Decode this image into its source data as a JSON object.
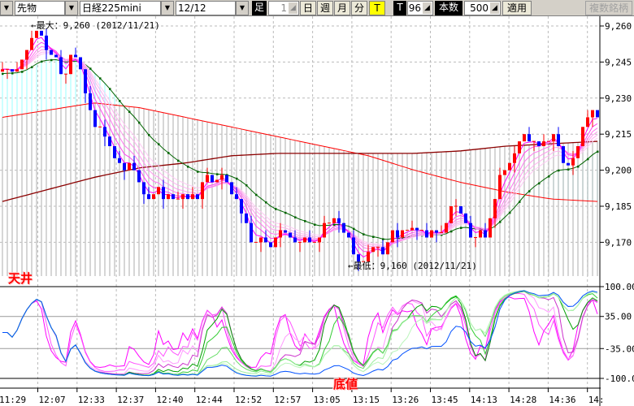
{
  "toolbar": {
    "market": "先物",
    "symbol": "日経225mini",
    "contract": "12/12",
    "ashi_label": "足",
    "period_value": "1",
    "day": "日",
    "week": "週",
    "month": "月",
    "minute": "分",
    "tick": "T",
    "t_label": "T",
    "t_value": "96",
    "count_label": "本数",
    "count_value": "500",
    "apply": "適用",
    "multi": "複数銘柄"
  },
  "annotations": {
    "max": "←最大：9,260 (2012/11/21)",
    "min": "←最低：9,160 (2012/11/21)",
    "top_label": "天井",
    "bottom_label": "底値"
  },
  "colors": {
    "up": "#ff0000",
    "down": "#0000ff",
    "ma_long": "#ff0000",
    "ma_longer": "#8b0000",
    "ma_mid": "#006400",
    "osc_blue": "#0050ff"
  },
  "chart_data": {
    "type": "candlestick",
    "price_axis": {
      "ticks": [
        "9,260",
        "9,245",
        "9,230",
        "9,215",
        "9,200",
        "9,185",
        "9,170"
      ],
      "values": [
        9260,
        9245,
        9230,
        9215,
        9200,
        9185,
        9170
      ]
    },
    "osc_axis": {
      "ticks": [
        "100.00",
        "35.00",
        "-35.00",
        "-100.00"
      ],
      "values": [
        100,
        35,
        -35,
        -100
      ]
    },
    "x_labels": [
      "11:29",
      "12:07",
      "12:33",
      "12:37",
      "12:40",
      "12:44",
      "12:52",
      "12:57",
      "13:05",
      "13:15",
      "13:26",
      "13:45",
      "14:13",
      "14:28",
      "14:36",
      "14:"
    ],
    "closes": [
      9242,
      9242,
      9241,
      9242,
      9246,
      9250,
      9255,
      9258,
      9256,
      9250,
      9248,
      9247,
      9240,
      9240,
      9248,
      9247,
      9242,
      9232,
      9225,
      9218,
      9218,
      9214,
      9210,
      9205,
      9203,
      9200,
      9203,
      9200,
      9195,
      9190,
      9188,
      9190,
      9193,
      9188,
      9190,
      9188,
      9188,
      9190,
      9188,
      9190,
      9188,
      9195,
      9198,
      9195,
      9196,
      9198,
      9195,
      9190,
      9188,
      9182,
      9178,
      9170,
      9170,
      9172,
      9170,
      9168,
      9172,
      9175,
      9174,
      9172,
      9170,
      9170,
      9172,
      9170,
      9170,
      9172,
      9178,
      9178,
      9180,
      9178,
      9174,
      9172,
      9165,
      9162,
      9162,
      9166,
      9168,
      9168,
      9165,
      9170,
      9175,
      9172,
      9175,
      9175,
      9176,
      9175,
      9175,
      9172,
      9175,
      9174,
      9174,
      9178,
      9185,
      9185,
      9182,
      9178,
      9172,
      9172,
      9175,
      9172,
      9180,
      9188,
      9198,
      9200,
      9203,
      9207,
      9212,
      9215,
      9212,
      9212,
      9210,
      9212,
      9212,
      9215,
      9210,
      9203,
      9202,
      9205,
      9210,
      9218,
      9222,
      9225,
      9222
    ],
    "ma_long_anchors": [
      9222,
      9225,
      9228,
      9226,
      9222,
      9218,
      9214,
      9210,
      9206,
      9200,
      9195,
      9191,
      9188,
      9187
    ],
    "ma_longer_anchors": [
      9187,
      9192,
      9197,
      9201,
      9203,
      9206,
      9207,
      9207,
      9207,
      9207,
      9208,
      9210,
      9211,
      9212
    ],
    "ribbon_periods": [
      3,
      5,
      7,
      9,
      11,
      13
    ],
    "mid_ema_period": 22,
    "max": 9260,
    "min": 9160
  }
}
